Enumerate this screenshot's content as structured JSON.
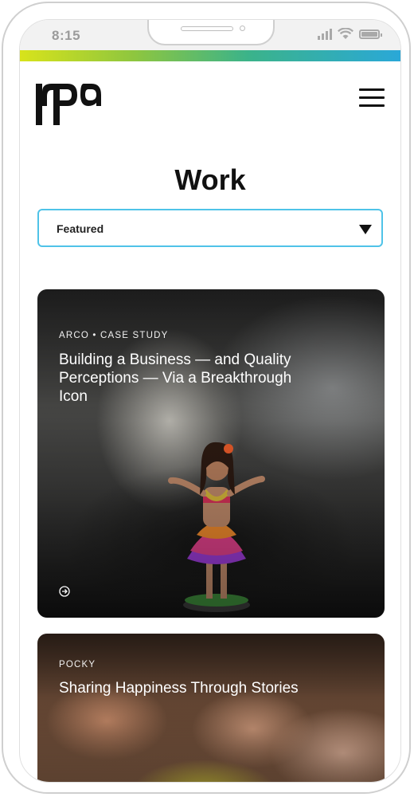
{
  "status_bar": {
    "time": "8:15",
    "icons": [
      "signal-icon",
      "wifi-icon",
      "battery-icon"
    ]
  },
  "accent_gradient": [
    "#d8e31b",
    "#8ec63f",
    "#3bb38a",
    "#2aa8d8"
  ],
  "header": {
    "logo_text": "rpa",
    "menu_icon": "hamburger-menu-icon"
  },
  "page": {
    "title": "Work"
  },
  "filter": {
    "selected": "Featured",
    "border_color": "#4fc3e8"
  },
  "cards": [
    {
      "eyebrow": "ARCO • CASE STUDY",
      "headline": "Building a Business — and Quality Perceptions — Via a Breakthrough Icon",
      "icon": "arrow-right-circle-icon"
    },
    {
      "eyebrow": "POCKY",
      "headline": "Sharing Happiness Through Stories"
    }
  ]
}
